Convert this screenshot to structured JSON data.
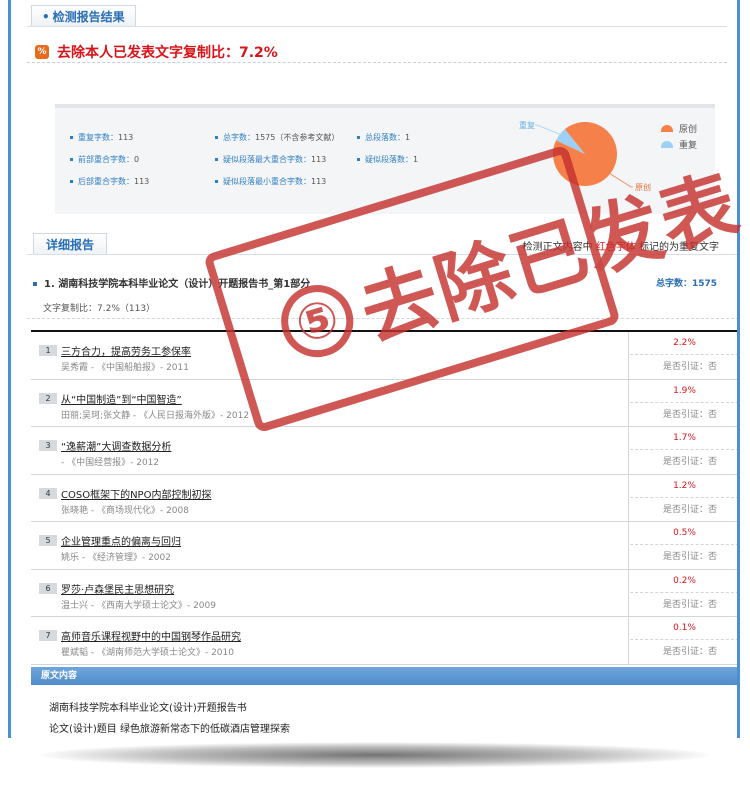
{
  "section_title": "检测报告结果",
  "headline": "去除本人已发表文字复制比：7.2%",
  "stats": {
    "dup_chars_label": "重复字数：",
    "dup_chars_value": "113",
    "total_chars_label": "总字数：",
    "total_chars_value": "1575（不含参考文献）",
    "total_paras_label": "总段落数：",
    "total_paras_value": "1",
    "front_dup_label": "前部重合字数：",
    "front_dup_value": "0",
    "max_para_dup_label": "疑似段落最大重合字数：",
    "max_para_dup_value": "113",
    "sus_paras_label": "疑似段落数：",
    "sus_paras_value": "1",
    "back_dup_label": "后部重合字数：",
    "back_dup_value": "113",
    "min_para_dup_label": "疑似段落最小重合字数：",
    "min_para_dup_value": "113"
  },
  "chart_data": {
    "type": "pie",
    "categories": [
      "原创",
      "重复"
    ],
    "values": [
      92.8,
      7.2
    ],
    "colors": [
      "#f5804a",
      "#9dd0f4"
    ],
    "slice_labels": [
      "原创",
      "重复"
    ],
    "legend": [
      "原创",
      "重复"
    ],
    "legend_placement": "right"
  },
  "detail_tab": "详细报告",
  "note": {
    "prefix": "检测正文内容中",
    "red": "红色字体",
    "suffix": "标记的为重复文字"
  },
  "doc": {
    "title": "1. 湖南科技学院本科毕业论文（设计）开题报告书_第1部分",
    "total": "总字数：1575",
    "copy_ratio": "文字复制比：7.2%（113）"
  },
  "results": [
    {
      "num": "1",
      "title": "三方合力，提高劳务工参保率",
      "meta": "吴秀霞 - 《中国船舶报》- 2011",
      "pct": "2.2%",
      "cite": "是否引证：否"
    },
    {
      "num": "2",
      "title": "从“中国制造”到“中国智造”",
      "meta": "田丽;吴珂;张文静 - 《人民日报海外版》- 2012",
      "pct": "1.9%",
      "cite": "是否引证：否"
    },
    {
      "num": "3",
      "title": "“逸薪潮”大调查数据分析",
      "meta": "- 《中国经营报》- 2012",
      "pct": "1.7%",
      "cite": "是否引证：否"
    },
    {
      "num": "4",
      "title": "COSO框架下的NPO内部控制初探",
      "meta": "张晓艳 - 《商场现代化》- 2008",
      "pct": "1.2%",
      "cite": "是否引证：否"
    },
    {
      "num": "5",
      "title": "企业管理重点的偏离与回归",
      "meta": "姚乐 - 《经济管理》- 2002",
      "pct": "0.5%",
      "cite": "是否引证：否"
    },
    {
      "num": "6",
      "title": "罗莎·卢森堡民主思想研究",
      "meta": "温士兴 - 《西南大学硕士论文》- 2009",
      "pct": "0.2%",
      "cite": "是否引证：否"
    },
    {
      "num": "7",
      "title": "高师音乐课程视野中的中国钢琴作品研究",
      "meta": "瞿斌韬 - 《湖南师范大学硕士论文》- 2010",
      "pct": "0.1%",
      "cite": "是否引证：否"
    }
  ],
  "orig_bar": "原文内容",
  "orig_lines": [
    "湖南科技学院本科毕业论文(设计)开题报告书",
    "论文(设计)题目 绿色旅游新常态下的低碳酒店管理探索"
  ],
  "stamp": {
    "circle": "⑤",
    "text": "去除已发表"
  }
}
